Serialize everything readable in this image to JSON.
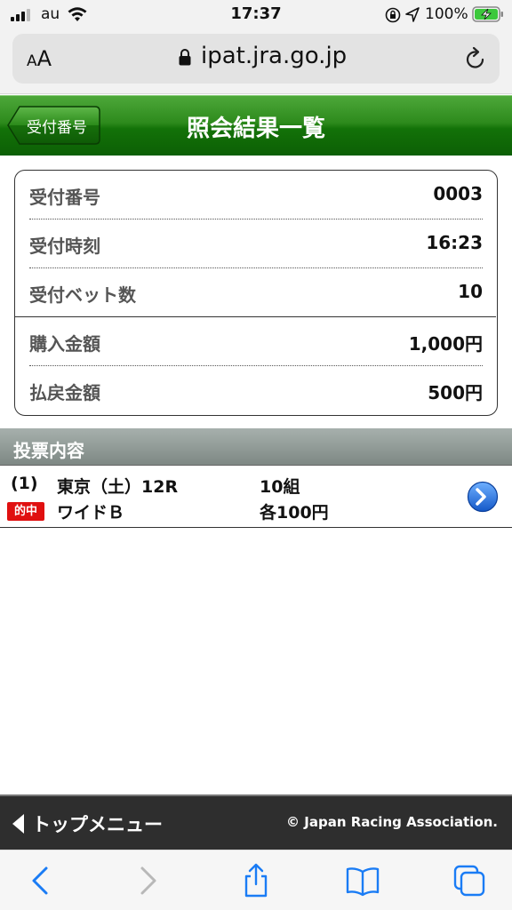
{
  "status_bar": {
    "carrier": "au",
    "time": "17:37",
    "battery_percent": "100%"
  },
  "browser": {
    "text_size_label_small": "A",
    "text_size_label_large": "A",
    "url": "ipat.jra.go.jp"
  },
  "header": {
    "back_label": "受付番号",
    "title": "照会結果一覧"
  },
  "summary": {
    "rows": [
      {
        "label": "受付番号",
        "value": "0003"
      },
      {
        "label": "受付時刻",
        "value": "16:23"
      },
      {
        "label": "受付ベット数",
        "value": "10"
      },
      {
        "label": "購入金額",
        "value": "1,000円"
      },
      {
        "label": "払戻金額",
        "value": "500円"
      }
    ]
  },
  "section": {
    "title": "投票内容"
  },
  "bets": [
    {
      "number": "(1)",
      "race": "東京（土）12R",
      "combinations": "10組",
      "badge": "的中",
      "bet_type": "ワイドＢ",
      "amount": "各100円"
    }
  ],
  "footer": {
    "top_menu_label": "トップメニュー",
    "copyright": "© Japan Racing Association."
  },
  "colors": {
    "header_green": "#137208",
    "hit_red": "#e01010",
    "safari_blue": "#1a7cf5"
  }
}
